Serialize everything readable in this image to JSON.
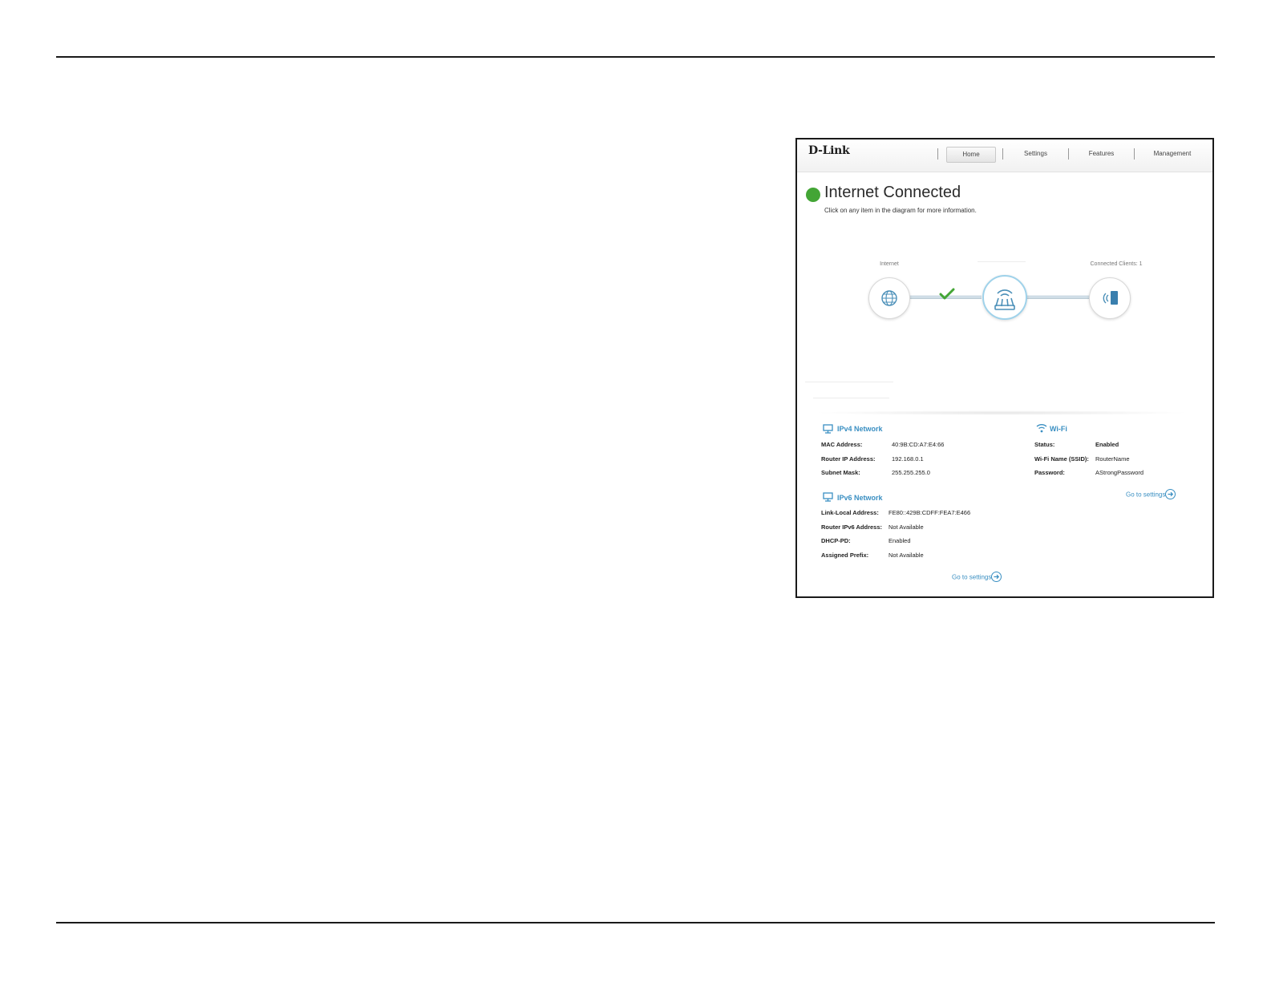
{
  "header": {
    "logo": "D-Link",
    "nav": [
      "Home",
      "Settings",
      "Features",
      "Management"
    ]
  },
  "status": {
    "title": "Internet Connected",
    "subtitle": "Click on any item in the diagram for more information.",
    "color": "#43a535"
  },
  "diagram": {
    "internet_label": "Internet",
    "clients_label": "Connected Clients: 1"
  },
  "ipv4": {
    "title": "IPv4 Network",
    "rows": [
      {
        "label": "MAC Address:",
        "value": "40:9B:CD:A7:E4:66"
      },
      {
        "label": "Router IP Address:",
        "value": "192.168.0.1"
      },
      {
        "label": "Subnet Mask:",
        "value": "255.255.255.0"
      }
    ]
  },
  "wifi": {
    "title": "Wi-Fi",
    "rows": [
      {
        "label": "Status:",
        "value": "Enabled"
      },
      {
        "label": "Wi-Fi Name (SSID):",
        "value": "RouterName"
      },
      {
        "label": "Password:",
        "value": "AStrongPassword"
      }
    ],
    "goto": "Go to settings"
  },
  "ipv6": {
    "title": "IPv6 Network",
    "rows": [
      {
        "label": "Link-Local Address:",
        "value": "FE80::429B:CDFF:FEA7:E466"
      },
      {
        "label": "Router IPv6 Address:",
        "value": "Not Available"
      },
      {
        "label": "DHCP-PD:",
        "value": "Enabled"
      },
      {
        "label": "Assigned Prefix:",
        "value": "Not Available"
      }
    ],
    "goto": "Go to settings"
  },
  "colors": {
    "accent": "#3a8fc2",
    "router_ring": "#9fd2ea"
  }
}
